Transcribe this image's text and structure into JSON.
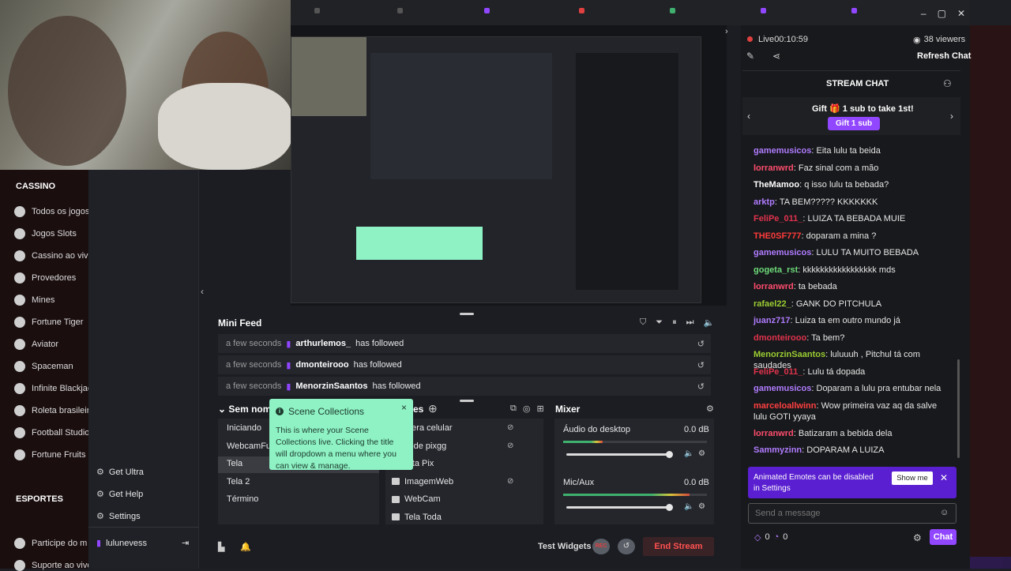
{
  "casino_site": {
    "section1": "CASSINO",
    "items1": [
      "Todos os jogos",
      "Jogos Slots",
      "Cassino ao vivo",
      "Provedores",
      "Mines",
      "Fortune Tiger",
      "Aviator",
      "Spaceman",
      "Infinite Blackjack",
      "Roleta brasileira",
      "Football Studio",
      "Fortune Fruits"
    ],
    "section2": "ESPORTES",
    "items2": [
      "Participe do m",
      "Suporte ao vivo"
    ]
  },
  "obs": {
    "nav": {
      "get_ultra": "Get Ultra",
      "get_help": "Get Help",
      "settings": "Settings",
      "user": "lulunevess"
    },
    "mini_feed": {
      "title": "Mini Feed",
      "rows": [
        {
          "time": "a few seconds",
          "user": "arthurlemos_",
          "action": "has followed"
        },
        {
          "time": "a few seconds",
          "user": "dmonteirooo",
          "action": "has followed"
        },
        {
          "time": "a few seconds",
          "user": "MenorzinSaantos",
          "action": "has followed"
        }
      ]
    },
    "scenes": {
      "title": "Sem nome",
      "items": [
        "Iniciando",
        "WebcamFull",
        "Tela",
        "Tela 2",
        "Término"
      ],
      "selected": "Tela"
    },
    "sources": {
      "title": "es",
      "items": [
        "mera celular",
        "code pixgg",
        "erta Pix",
        "ImagemWeb",
        "WebCam",
        "Tela Toda"
      ]
    },
    "mixer": {
      "title": "Mixer",
      "channels": [
        {
          "name": "Áudio do desktop",
          "db": "0.0 dB"
        },
        {
          "name": "Mic/Aux",
          "db": "0.0 dB"
        }
      ]
    },
    "tooltip": {
      "title": "Scene Collections",
      "body": "This is where your Scene Collections live. Clicking the title will dropdown a menu where you can view & manage.",
      "close": "×"
    },
    "bottom": {
      "test_widgets": "Test Widgets",
      "rec": "REC",
      "end_stream": "End Stream"
    }
  },
  "chat": {
    "live": "Live",
    "time": "00:10:59",
    "viewers": "38 viewers",
    "refresh": "Refresh Chat",
    "header": "STREAM CHAT",
    "gift_text_a": "Gift",
    "gift_text_b": "1 sub to take 1st!",
    "gift_btn": "Gift 1 sub",
    "messages": [
      {
        "name": "gamemusicos",
        "color": "#b07cff",
        "text": "Eita lulu ta beida"
      },
      {
        "name": "lorranwrd",
        "color": "#ff4d6d",
        "text": "Faz sinal com a mão"
      },
      {
        "name": "TheMamoo",
        "color": "#ffffff",
        "text": "q isso lulu ta bebada?"
      },
      {
        "name": "arktp",
        "color": "#b07cff",
        "text": "TA BEM????? KKKKKKK"
      },
      {
        "name": "FeliPe_011_",
        "color": "#e0334d",
        "text": "LUIZA TA BEBADA MUIE"
      },
      {
        "name": "THE0SF777",
        "color": "#ff3b3b",
        "text": "doparam a mina ?"
      },
      {
        "name": "gamemusicos",
        "color": "#b07cff",
        "text": "LULU TA MUITO BEBADA"
      },
      {
        "name": "gogeta_rst",
        "color": "#6ddc7a",
        "text": "kkkkkkkkkkkkkkkkk mds"
      },
      {
        "name": "lorranwrd",
        "color": "#ff4d6d",
        "text": "ta bebada"
      },
      {
        "name": "rafael22_",
        "color": "#9acd32",
        "text": "GANK DO PITCHULA"
      },
      {
        "name": "juanz717",
        "color": "#b07cff",
        "text": "Luiza ta em outro mundo já"
      },
      {
        "name": "dmonteirooo",
        "color": "#e0334d",
        "text": "Ta bem?"
      },
      {
        "name": "MenorzinSaantos",
        "color": "#9acd32",
        "text": "luluuuh , Pitchul tá com saudades"
      },
      {
        "name": "FeliPe_011_",
        "color": "#e0334d",
        "text": "Lulu tá dopada"
      },
      {
        "name": "gamemusicos",
        "color": "#b07cff",
        "text": "Doparam a lulu pra entubar nela"
      },
      {
        "name": "marceloallwinn",
        "color": "#ff4040",
        "text": "Wow primeira vaz aq da salve lulu GOTI yyaya"
      },
      {
        "name": "lorranwrd",
        "color": "#ff4d6d",
        "text": "Batizaram a bebida dela"
      },
      {
        "name": "Sammyzinn",
        "color": "#b07cff",
        "text": "DOPARAM A LUIZA"
      }
    ],
    "notice": "Animated Emotes can be disabled in Settings",
    "show_me": "Show me",
    "input_placeholder": "Send a message",
    "points_a": "0",
    "points_b": "0",
    "chat_btn": "Chat"
  }
}
